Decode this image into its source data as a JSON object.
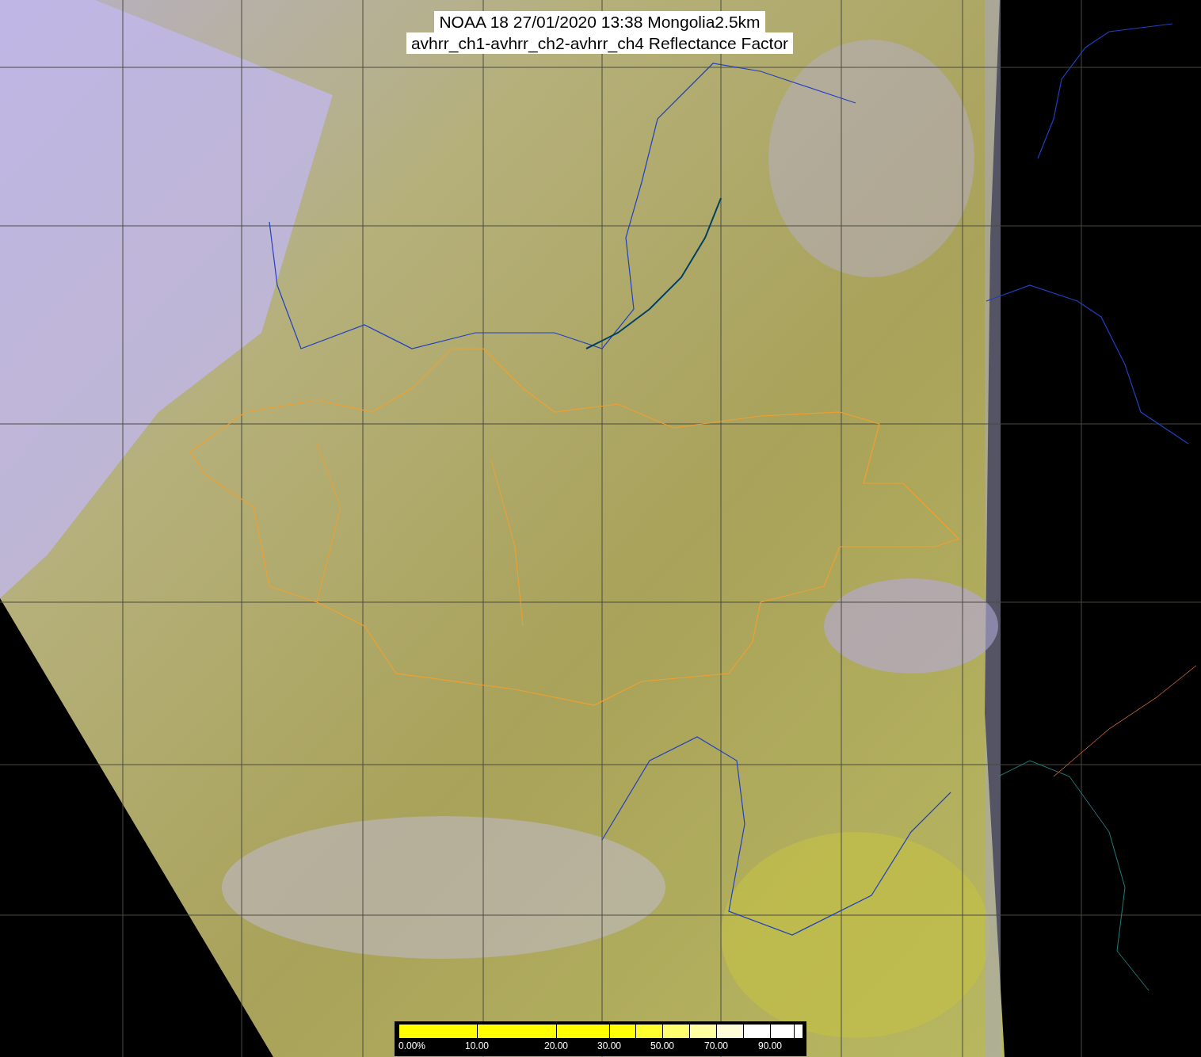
{
  "title": {
    "lines": [
      "NOAA 18 27/01/2020 13:38 Mongolia2.5km",
      "avhrr_ch1-avhrr_ch2-avhrr_ch4 Reflectance Factor"
    ]
  },
  "legend": {
    "segments": [
      {
        "color": "#ffff00",
        "label": "0.00%"
      },
      {
        "color": "#ffff00",
        "label": "10.00"
      },
      {
        "color": "#ffff00",
        "label": "20.00"
      },
      {
        "color": "#ffff08",
        "label": "30.00"
      },
      {
        "color": "#ffff30"
      },
      {
        "color": "#ffff70",
        "label": "50.00"
      },
      {
        "color": "#ffffa0"
      },
      {
        "color": "#fffcd8",
        "label": "70.00"
      },
      {
        "color": "#ffffff"
      },
      {
        "color": "#ffffff",
        "label": "90.00"
      },
      {
        "color": "#ffffff"
      }
    ]
  }
}
